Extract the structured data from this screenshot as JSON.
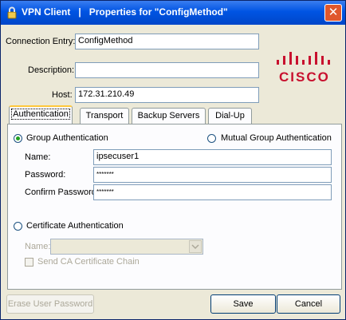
{
  "window": {
    "title": "VPN Client   |   Properties for \"ConfigMethod\"",
    "close_symbol": "✕",
    "title_icon": "padlock-icon",
    "close_icon": "close-icon"
  },
  "header": {
    "connection_entry_label": "Connection Entry:",
    "connection_entry_value": "ConfigMethod",
    "description_label": "Description:",
    "description_value": "",
    "host_label": "Host:",
    "host_value": "172.31.210.49",
    "logo_text": "CISCO",
    "logo_color": "#c8102e"
  },
  "tabs": [
    {
      "label": "Authentication",
      "active": true
    },
    {
      "label": "Transport"
    },
    {
      "label": "Backup Servers"
    },
    {
      "label": "Dial-Up"
    }
  ],
  "auth": {
    "group_auth_label": "Group Authentication",
    "mutual_group_auth_label": "Mutual Group Authentication",
    "selected": "group",
    "name_label": "Name:",
    "name_value": "ipsecuser1",
    "password_label": "Password:",
    "password_value": "*******",
    "confirm_password_label": "Confirm Password:",
    "confirm_password_value": "*******",
    "cert_auth_label": "Certificate Authentication",
    "cert_name_label": "Name:",
    "cert_name_value": "",
    "send_ca_chain_label": "Send CA Certificate Chain"
  },
  "footer": {
    "erase_label": "Erase User Password",
    "save_label": "Save",
    "cancel_label": "Cancel"
  }
}
